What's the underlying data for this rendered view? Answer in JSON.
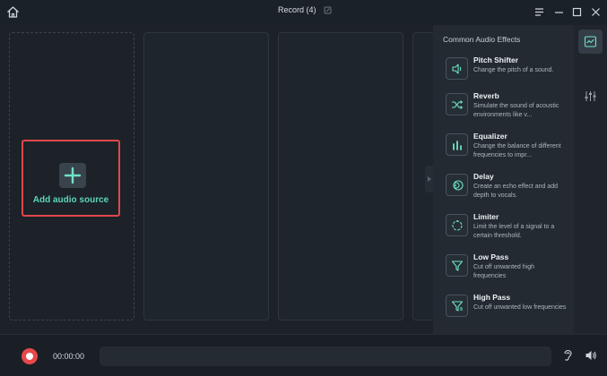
{
  "window": {
    "title": "Record (4)",
    "icons": [
      "home-icon",
      "edit-title-icon",
      "menu-icon",
      "minimize-icon",
      "maximize-icon",
      "close-icon"
    ]
  },
  "tracks": {
    "add_source_label": "Add audio source"
  },
  "effects": {
    "title": "Common Audio Effects",
    "items": [
      {
        "name": "Pitch Shifter",
        "desc": "Change the pitch of a sound.",
        "icon": "pitch-shifter-icon"
      },
      {
        "name": "Reverb",
        "desc": "Simulate the sound of acoustic environments like v...",
        "icon": "reverb-icon"
      },
      {
        "name": "Equalizer",
        "desc": "Change the balance of different frequencies to impr...",
        "icon": "equalizer-icon"
      },
      {
        "name": "Delay",
        "desc": "Create an echo effect and add depth to vocals.",
        "icon": "delay-icon"
      },
      {
        "name": "Limiter",
        "desc": "Limit the level of a signal to a certain threshold.",
        "icon": "limiter-icon"
      },
      {
        "name": "Low Pass",
        "desc": "Cut off unwanted high frequencies",
        "icon": "low-pass-icon"
      },
      {
        "name": "High Pass",
        "desc": "Cut off unwanted low frequencies",
        "icon": "high-pass-icon"
      }
    ]
  },
  "toolstrip": {
    "icons": [
      "effects-panel-icon",
      "mixer-icon"
    ]
  },
  "bottombar": {
    "time": "00:00:00",
    "icons": [
      "record-icon",
      "monitor-ear-icon",
      "volume-icon"
    ]
  },
  "colors": {
    "accent": "#5fd6b6",
    "record": "#e8474b",
    "highlight_border": "#e0474c"
  }
}
